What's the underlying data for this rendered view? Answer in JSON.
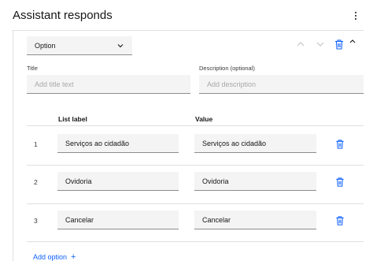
{
  "header": {
    "title": "Assistant responds"
  },
  "response_type": {
    "selected": "Option"
  },
  "title_field": {
    "label": "Title",
    "placeholder": "Add title text"
  },
  "description_field": {
    "label": "Description (optional)",
    "placeholder": "Add description"
  },
  "table": {
    "headers": {
      "list_label": "List label",
      "value": "Value"
    },
    "rows": [
      {
        "num": "1",
        "label": "Serviços ao cidadão",
        "value": "Serviços ao cidadão"
      },
      {
        "num": "2",
        "label": "Ovidoria",
        "value": "Ovidoria"
      },
      {
        "num": "3",
        "label": "Cancelar",
        "value": "Cancelar"
      }
    ]
  },
  "add_option": {
    "label": "Add option",
    "icon": "+"
  },
  "colors": {
    "accent": "#0f62fe",
    "field_bg": "#f4f4f4",
    "disabled_icon": "#c6c6c6"
  }
}
